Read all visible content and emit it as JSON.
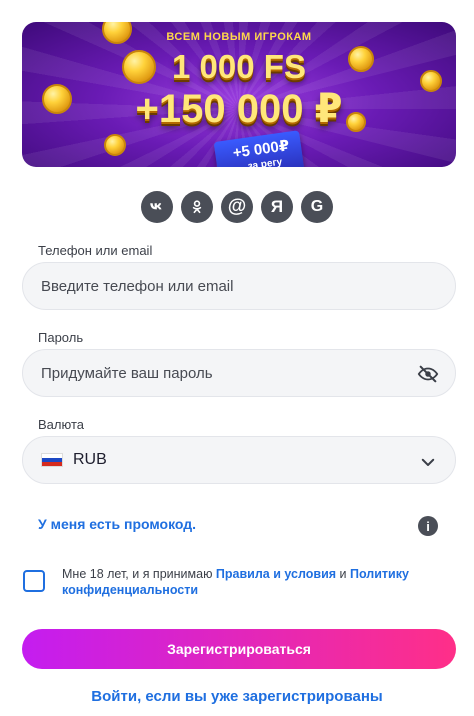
{
  "banner": {
    "top_line": "ВСЕМ НОВЫМ ИГРОКАМ",
    "bonus_fs": "1 000 FS",
    "bonus_money": "+150 000 ₽",
    "ticket_amount": "+5 000₽",
    "ticket_sub": "за регу"
  },
  "socials": [
    {
      "name": "vk-icon",
      "glyph": "vk"
    },
    {
      "name": "odnoklassniki-icon",
      "glyph": "ok"
    },
    {
      "name": "mailru-icon",
      "glyph": "@"
    },
    {
      "name": "yandex-icon",
      "glyph": "Я"
    },
    {
      "name": "google-icon",
      "glyph": "G"
    }
  ],
  "form": {
    "phone_label": "Телефон или email",
    "phone_placeholder": "Введите телефон или email",
    "password_label": "Пароль",
    "password_placeholder": "Придумайте ваш пароль",
    "currency_label": "Валюта",
    "currency_value": "RUB",
    "promo_link": "У меня есть промокод.",
    "info_glyph": "i"
  },
  "terms": {
    "text_before": "Мне 18 лет, и я принимаю ",
    "rules_link": "Правила и условия",
    "text_middle": " и ",
    "privacy_link": "Политику конфиденциальности"
  },
  "actions": {
    "register_label": "Зарегистрироваться",
    "login_link": "Войти, если вы уже зарегистрированы"
  },
  "colors": {
    "accent_blue": "#1f6fe0",
    "button_gradient_start": "#c41df0",
    "button_gradient_end": "#ff2f88",
    "banner_purple": "#6a1bb5",
    "icon_gray": "#4a4e57"
  }
}
